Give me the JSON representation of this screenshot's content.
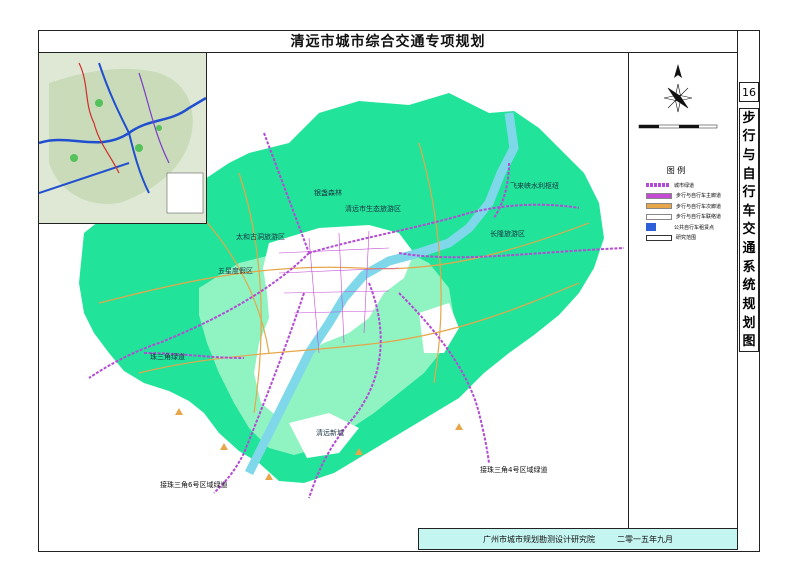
{
  "title": "清远市城市综合交通专项规划",
  "sheet_number": "16",
  "vertical_title_chars": [
    "步",
    "行",
    "与",
    "自",
    "行",
    "车",
    "交",
    "通",
    "系",
    "统",
    "规",
    "划",
    "图"
  ],
  "legend": {
    "title": "图 例",
    "items": [
      {
        "label": "城市绿道",
        "color": "#b44ad6"
      },
      {
        "label": "步行与自行车主廊道",
        "color": "#c44ad6"
      },
      {
        "label": "步行与自行车次廊道",
        "color": "#e7a64a"
      },
      {
        "label": "步行与自行车联络道",
        "color": "#ffffff"
      },
      {
        "label": "公共自行车租赁点",
        "color": "#2d5fd8"
      },
      {
        "label": "研究范围",
        "color": "#ffffff"
      }
    ]
  },
  "map_labels": [
    "银盏森林",
    "清远市生态旅游区",
    "长隆旅游区",
    "飞来峡水利枢纽",
    "太和古洞旅游区",
    "五星度假区",
    "珠三角绿道",
    "清远新城"
  ],
  "connection_notes": {
    "left": "接珠三角6号区域绿道",
    "right": "接珠三角4号区域绿道"
  },
  "footer": {
    "institute": "广州市城市规划勘测设计研究院",
    "date": "二零一五年九月"
  },
  "colors": {
    "green_space": "#22e39a",
    "light_green": "#8ff3c2",
    "built_up": "#ffffff",
    "greenway": "#b44ad6",
    "secondary_corridor": "#e7a64a",
    "river": "#7fd8ea"
  }
}
